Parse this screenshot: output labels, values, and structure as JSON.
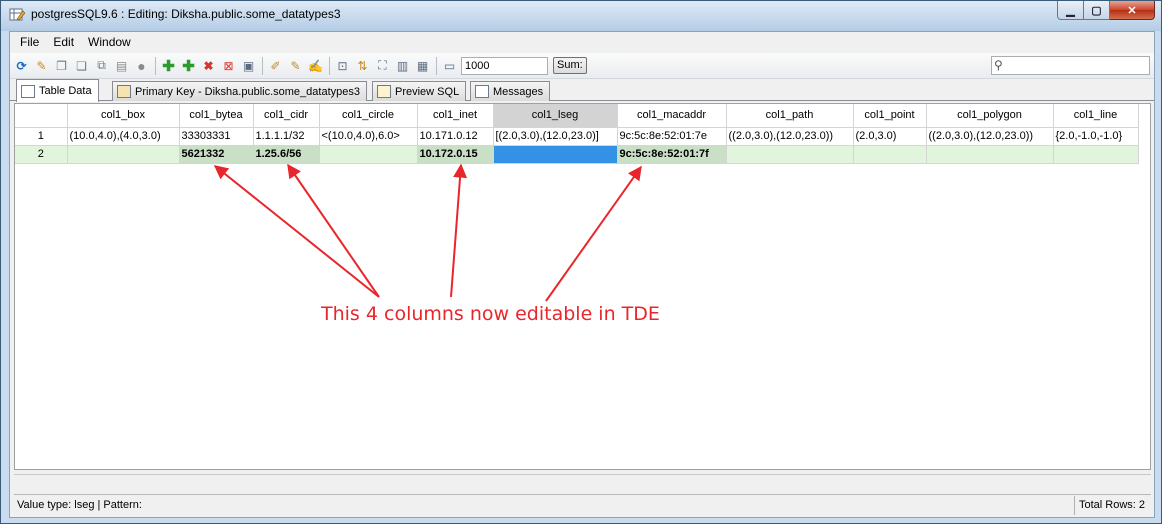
{
  "window": {
    "title": "postgresSQL9.6 : Editing: Diksha.public.some_datatypes3"
  },
  "menu": [
    "File",
    "Edit",
    "Window"
  ],
  "toolbar": {
    "limit_value": "1000",
    "sum_label": "Sum:",
    "search_placeholder": ""
  },
  "tabs": [
    {
      "label": "Table Data",
      "active": true
    },
    {
      "label": "Primary Key - Diksha.public.some_datatypes3",
      "active": false
    },
    {
      "label": "Preview SQL",
      "active": false
    },
    {
      "label": "Messages",
      "active": false
    }
  ],
  "grid": {
    "columns": [
      "col1_box",
      "col1_bytea",
      "col1_cidr",
      "col1_circle",
      "col1_inet",
      "col1_lseg",
      "col1_macaddr",
      "col1_path",
      "col1_point",
      "col1_polygon",
      "col1_line"
    ],
    "rows": [
      {
        "num": "1",
        "cells": [
          "(10.0,4.0),(4.0,3.0)",
          "33303331",
          "1.1.1.1/32",
          "<(10.0,4.0),6.0>",
          "10.171.0.12",
          "[(2.0,3.0),(12.0,23.0)]",
          "9c:5c:8e:52:01:7e",
          "((2.0,3.0),(12.0,23.0))",
          "(2.0,3.0)",
          "((2.0,3.0),(12.0,23.0))",
          "{2.0,-1.0,-1.0}"
        ]
      },
      {
        "num": "2",
        "cells": [
          "",
          "5621332",
          "1.25.6/56",
          "",
          "10.172.0.15",
          "",
          "9c:5c:8e:52:01:7f",
          "",
          "",
          "",
          ""
        ]
      }
    ]
  },
  "annotation": "This 4 columns now editable in TDE",
  "status": {
    "left": "Value type: lseg | Pattern:",
    "right": "Total Rows: 2"
  },
  "colors": {
    "annotation": "#e8262c",
    "edit_row": "#e0f5dc",
    "selected_cell": "#3392e6"
  }
}
